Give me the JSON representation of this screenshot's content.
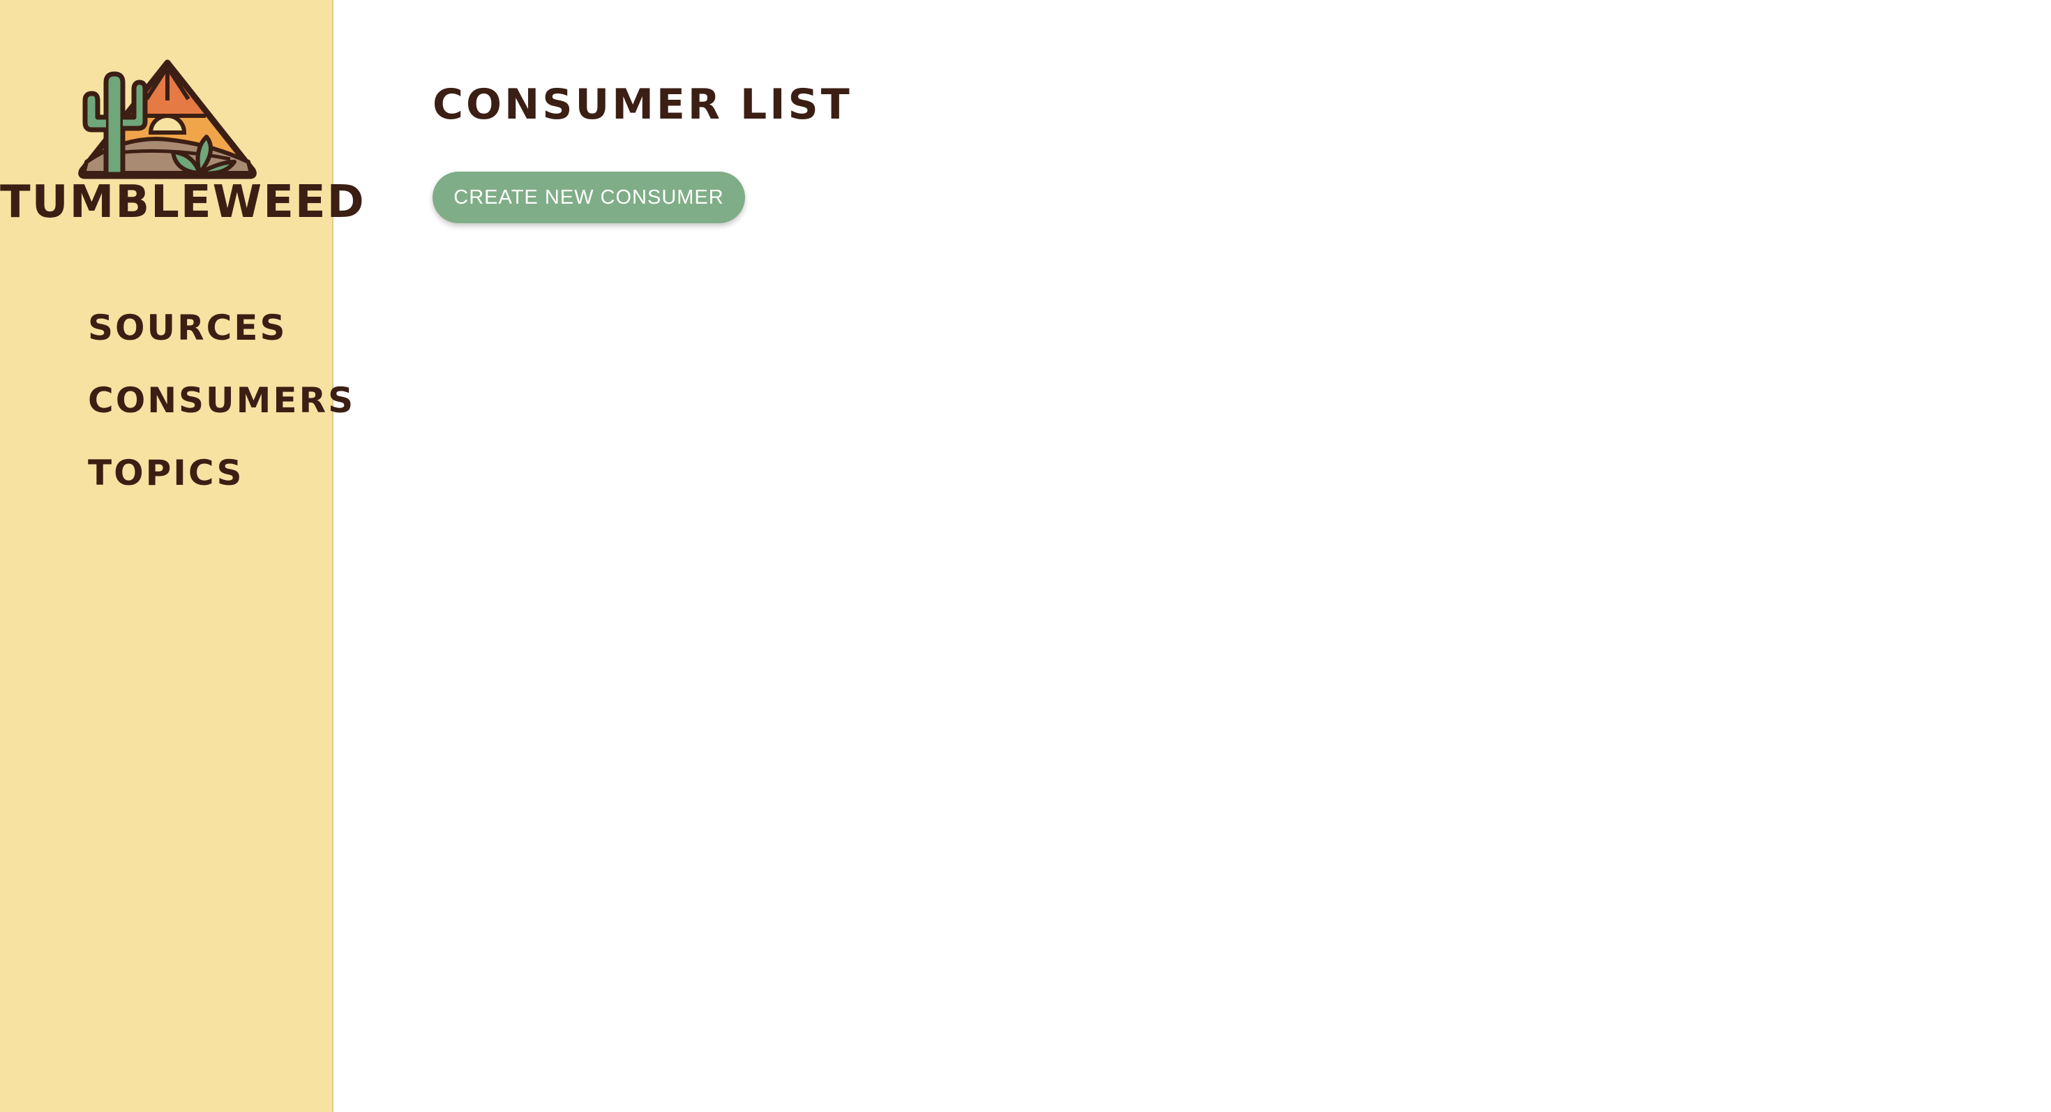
{
  "brand": {
    "name": "TUMBLEWEED"
  },
  "sidebar": {
    "items": [
      {
        "label": "SOURCES"
      },
      {
        "label": "CONSUMERS"
      },
      {
        "label": "TOPICS"
      }
    ]
  },
  "main": {
    "title": "CONSUMER LIST",
    "create_button_label": "CREATE NEW CONSUMER"
  },
  "colors": {
    "sidebar_bg": "#f8e2a2",
    "text_dark": "#3b1f14",
    "button_green": "#7fad87",
    "cactus_green": "#6fa77a",
    "sun_orange": "#e8834a",
    "sand_brown": "#a98b74"
  },
  "icons": {
    "logo": "desert-cactus-sunset-icon"
  }
}
